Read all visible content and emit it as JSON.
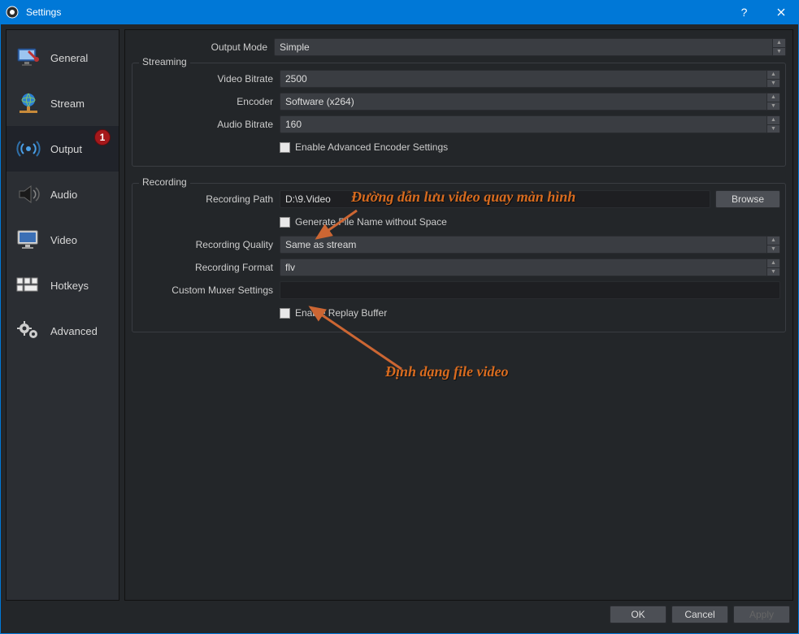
{
  "titlebar": {
    "title": "Settings"
  },
  "sidebar": {
    "items": [
      {
        "label": "General"
      },
      {
        "label": "Stream"
      },
      {
        "label": "Output",
        "badge": "1"
      },
      {
        "label": "Audio"
      },
      {
        "label": "Video"
      },
      {
        "label": "Hotkeys"
      },
      {
        "label": "Advanced"
      }
    ]
  },
  "main": {
    "output_mode_label": "Output Mode",
    "output_mode_value": "Simple",
    "streaming": {
      "title": "Streaming",
      "video_bitrate_label": "Video Bitrate",
      "video_bitrate_value": "2500",
      "encoder_label": "Encoder",
      "encoder_value": "Software (x264)",
      "audio_bitrate_label": "Audio Bitrate",
      "audio_bitrate_value": "160",
      "enable_adv_label": "Enable Advanced Encoder Settings"
    },
    "recording": {
      "title": "Recording",
      "path_label": "Recording Path",
      "path_value": "D:\\9.Video",
      "browse": "Browse",
      "gen_filename_label": "Generate File Name without Space",
      "quality_label": "Recording Quality",
      "quality_value": "Same as stream",
      "format_label": "Recording Format",
      "format_value": "flv",
      "muxer_label": "Custom Muxer Settings",
      "muxer_value": "",
      "replay_label": "Enable Replay Buffer"
    }
  },
  "footer": {
    "ok": "OK",
    "cancel": "Cancel",
    "apply": "Apply"
  },
  "annotations": {
    "a1": "Đường dẫn lưu video quay màn hình",
    "a2": "Định dạng file video"
  }
}
